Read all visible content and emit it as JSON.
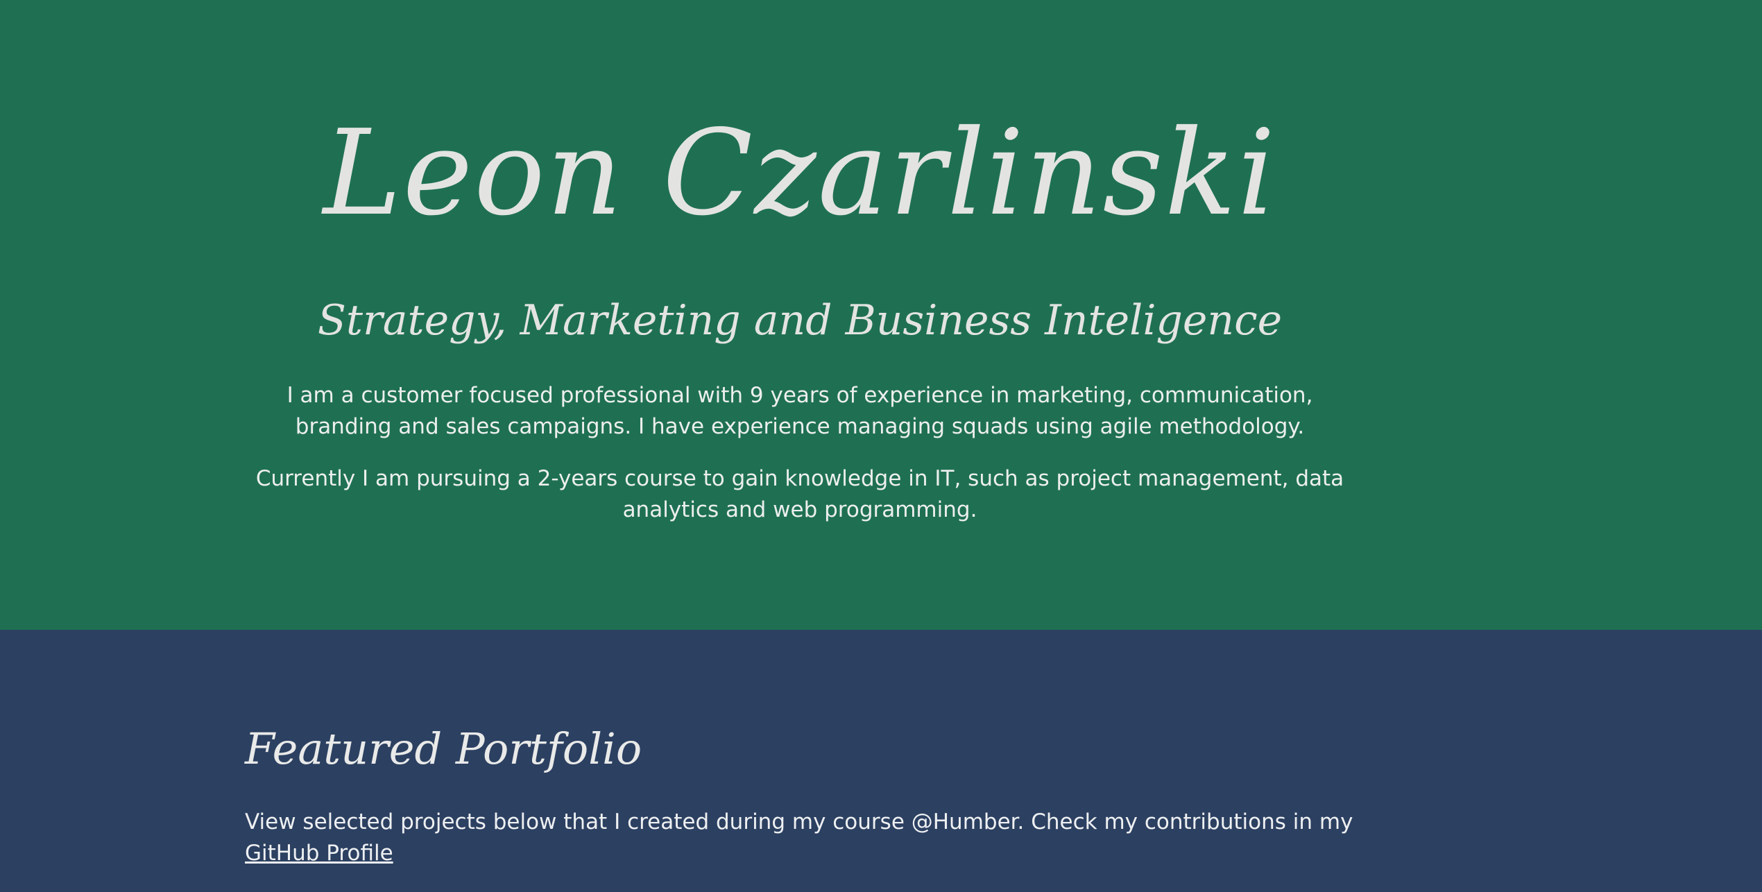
{
  "hero": {
    "name": "Leon Czarlinski",
    "tagline": "Strategy, Marketing and Business Inteligence",
    "bio_paragraphs": [
      "I am a customer focused professional with 9 years of experience in marketing, communication, branding and sales campaigns. I have experience managing squads using agile methodology.",
      "Currently I am pursuing a 2-years course to gain knowledge in IT, such as project management, data analytics and web programming."
    ]
  },
  "portfolio": {
    "title": "Featured Portfolio",
    "intro_text": "View selected projects below that I created during my course @Humber. Check my contributions in my",
    "github_link_label": "GitHub Profile"
  },
  "colors": {
    "hero_background": "#1f7052",
    "portfolio_background": "#2c4061",
    "text": "#e3e4e2"
  }
}
